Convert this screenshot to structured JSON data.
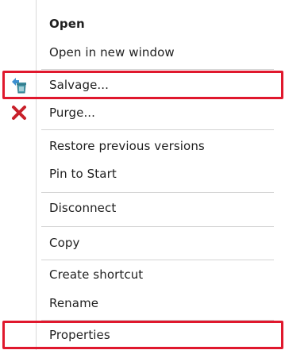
{
  "menu": {
    "items": [
      {
        "label": "Open"
      },
      {
        "label": "Open in new window"
      },
      {
        "label": "Salvage...",
        "icon": "salvage-icon"
      },
      {
        "label": "Purge...",
        "icon": "close-icon"
      },
      {
        "label": "Restore previous versions"
      },
      {
        "label": "Pin to Start"
      },
      {
        "label": "Disconnect"
      },
      {
        "label": "Copy"
      },
      {
        "label": "Create shortcut"
      },
      {
        "label": "Rename"
      },
      {
        "label": "Properties"
      }
    ]
  },
  "colors": {
    "highlight": "#e0182d",
    "purge_icon": "#c8202a",
    "salvage_icon": "#3c8fd0"
  }
}
